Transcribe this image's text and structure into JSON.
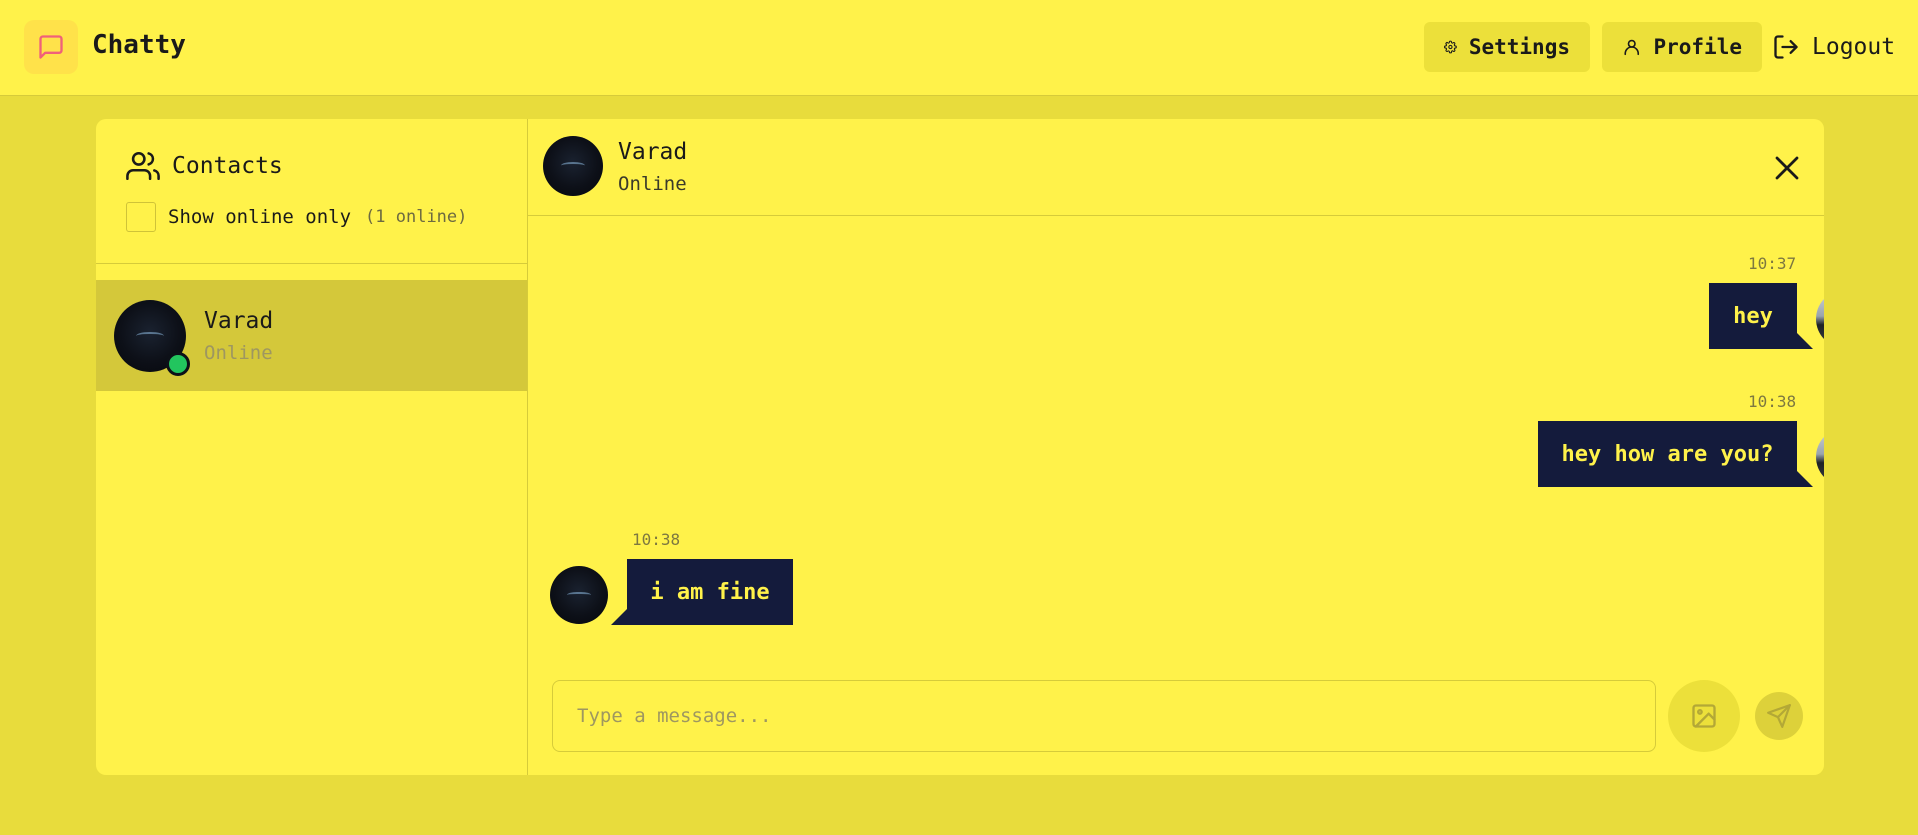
{
  "header": {
    "app_title": "Chatty",
    "logo_icon": "message-square-icon",
    "settings_label": "Settings",
    "profile_label": "Profile",
    "logout_label": "Logout"
  },
  "sidebar": {
    "title": "Contacts",
    "filter_label": "Show online only",
    "online_count": "(1 online)",
    "contacts": [
      {
        "name": "Varad",
        "status": "Online"
      }
    ]
  },
  "chat": {
    "contact_name": "Varad",
    "contact_status": "Online",
    "messages": [
      {
        "direction": "sent",
        "time": "10:37",
        "text": "hey"
      },
      {
        "direction": "sent",
        "time": "10:38",
        "text": "hey how are you?"
      },
      {
        "direction": "received",
        "time": "10:38",
        "text": "i am fine"
      }
    ],
    "input_placeholder": "Type a message..."
  },
  "colors": {
    "background": "#e8dc3c",
    "surface": "#fff24a",
    "bubble": "#141b3c",
    "bubble_text": "#fff24a",
    "online_dot": "#22c55e"
  }
}
